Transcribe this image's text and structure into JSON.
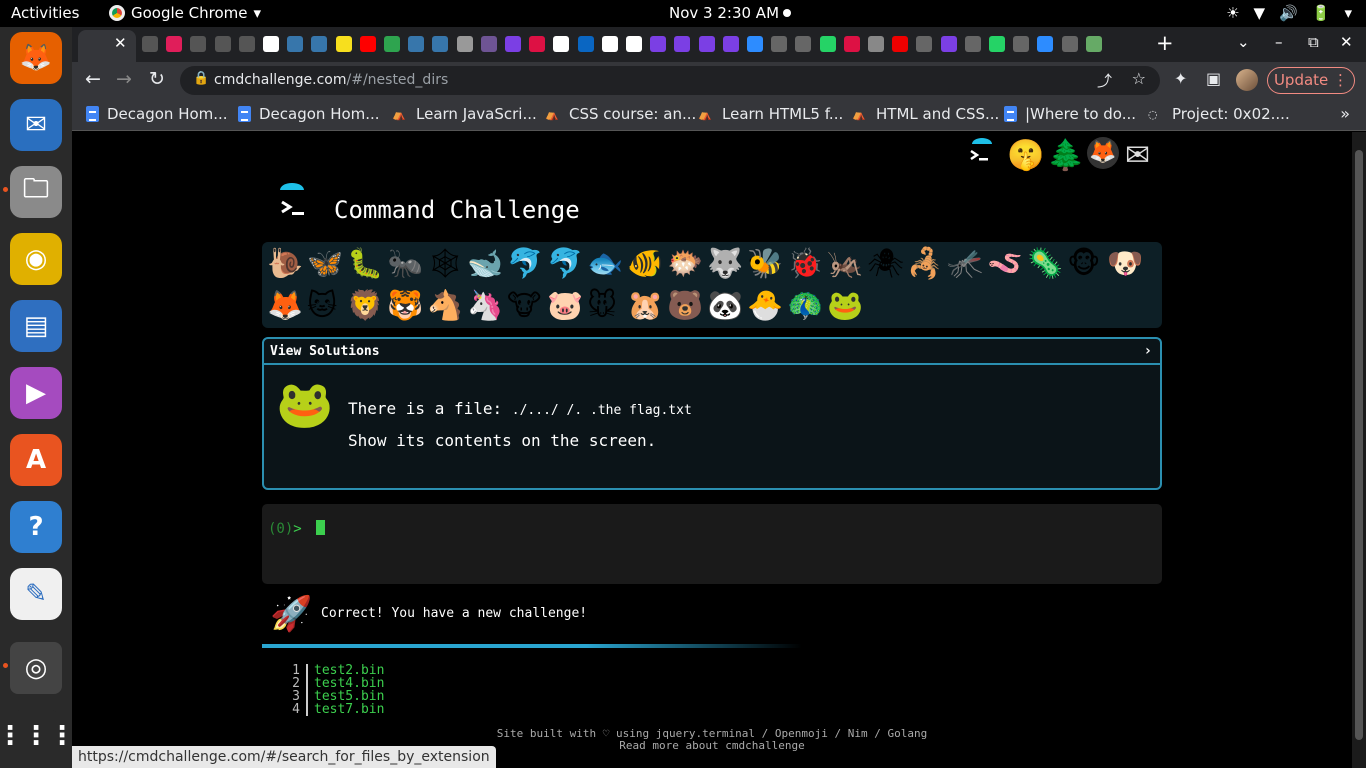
{
  "topbar": {
    "activities": "Activities",
    "app_name": "Google Chrome",
    "app_menu_arrow": "▾",
    "datetime": "Nov 3  2:30 AM",
    "tray": [
      "☀",
      "▼",
      "🔊",
      "🔋",
      "▾"
    ]
  },
  "dock": {
    "items": [
      {
        "name": "firefox",
        "glyph": "🦊",
        "color": "#e66000"
      },
      {
        "name": "thunderbird",
        "glyph": "✉",
        "color": "#2a6fbf"
      },
      {
        "name": "files",
        "glyph": "🗀",
        "color": "#8a8a8a"
      },
      {
        "name": "rhythmbox",
        "glyph": "◉",
        "color": "#e0b000"
      },
      {
        "name": "writer",
        "glyph": "▤",
        "color": "#2f6fc0"
      },
      {
        "name": "videos",
        "glyph": "▶",
        "color": "#a54bbf"
      },
      {
        "name": "software",
        "glyph": "A",
        "color": "#e95420"
      },
      {
        "name": "help",
        "glyph": "?",
        "color": "#2f7fd0"
      },
      {
        "name": "text-editor",
        "glyph": "✎",
        "color": "#f0f0f0"
      },
      {
        "name": "chrome",
        "glyph": "◎",
        "color": "#3a3a3a"
      },
      {
        "name": "app-grid",
        "glyph": "⋮⋮⋮",
        "color": "#2a2a2a"
      }
    ]
  },
  "tabs": {
    "close": "✕",
    "new_tab": "+",
    "favicons": [
      "#555",
      "#e01e5a",
      "#555",
      "#555",
      "#555",
      "#fff",
      "#3776ab",
      "#3776ab",
      "#f7df1e",
      "#ff0000",
      "#2ea44f",
      "#3776ab",
      "#3776ab",
      "#999",
      "#6e5494",
      "#7b3fe4",
      "#d14",
      "#fff",
      "#0a66c2",
      "#fff",
      "#fff",
      "#7b3fe4",
      "#7b3fe4",
      "#7b3fe4",
      "#7b3fe4",
      "#2d8cff",
      "#666",
      "#666",
      "#25d366",
      "#d14",
      "#888",
      "#e00",
      "#666",
      "#7b3fe4",
      "#666",
      "#25d366",
      "#666",
      "#2d8cff",
      "#666",
      "#6a6"
    ]
  },
  "toolbar": {
    "back": "←",
    "forward": "→",
    "reload": "↻",
    "lock": "🔒",
    "url_domain": "cmdchallenge.com",
    "url_path": "/#/nested_dirs",
    "share": "⤴",
    "star": "☆",
    "extensions": "✦",
    "sidepanel": "▣",
    "update": "Update",
    "menu": "⋮"
  },
  "bookmarks": [
    {
      "label": "Decagon Hom...",
      "icon": "doc"
    },
    {
      "label": "Decagon Hom...",
      "icon": "doc"
    },
    {
      "label": "Learn JavaScri...",
      "icon": "fcc"
    },
    {
      "label": "CSS course: an...",
      "icon": "fcc"
    },
    {
      "label": "Learn HTML5 f...",
      "icon": "fcc"
    },
    {
      "label": "HTML and CSS...",
      "icon": "fcc"
    },
    {
      "label": "|Where to do...",
      "icon": "doc"
    },
    {
      "label": "Project: 0x02....",
      "icon": "alx"
    }
  ],
  "bookmarks_more": "»",
  "page": {
    "top_icons": [
      "🐟",
      "🤫",
      "🌲",
      "🦊",
      "✉"
    ],
    "title": "Command Challenge",
    "emojis_row1": [
      "🐌",
      "🦋",
      "🐛",
      "🐜",
      "🕸",
      "🐋",
      "🐬",
      "🐬",
      "🐟",
      "🐠",
      "🐡",
      "🐺",
      "🐝",
      "🐞",
      "🦗",
      "🕷",
      "🦂",
      "🦟",
      "🪱",
      "🦠",
      "🐵",
      "🐶"
    ],
    "emojis_row2": [
      "🦊",
      "🐱",
      "🦁",
      "🐯",
      "🐴",
      "🦄",
      "🐮",
      "🐷",
      "🐭",
      "🐹",
      "🐻",
      "🐼",
      "🐣",
      "🦚",
      "🐸"
    ],
    "view_solutions": "View Solutions",
    "chevron": "›",
    "frog": "🐸",
    "challenge_text_prefix": "There is a file: ",
    "challenge_text_code": "./.../ /. .the flag.txt",
    "challenge_text_line2": "Show its contents on the screen.",
    "prompt_num": "(0)",
    "prompt_arrow": "> ",
    "rocket": "🚀",
    "result_message": "Correct! You have a new challenge!",
    "files": [
      {
        "n": "1",
        "name": "test2.bin"
      },
      {
        "n": "2",
        "name": "test4.bin"
      },
      {
        "n": "3",
        "name": "test5.bin"
      },
      {
        "n": "4",
        "name": "test7.bin"
      }
    ],
    "footer_line1": "Site built with ♡ using jquery.terminal / Openmoji / Nim / Golang",
    "footer_line2": "Read more about cmdchallenge"
  },
  "status_bar_url": "https://cmdchallenge.com/#/search_for_files_by_extension"
}
